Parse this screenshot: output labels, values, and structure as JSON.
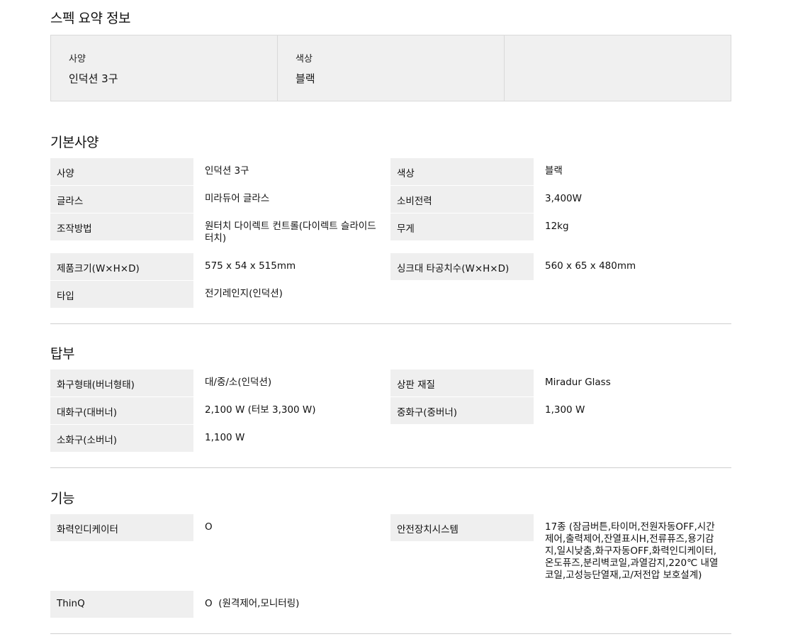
{
  "summary": {
    "title": "스펙 요약 정보",
    "items": [
      {
        "label": "사양",
        "value": "인덕션 3구"
      },
      {
        "label": "색상",
        "value": "블랙"
      },
      {
        "label": "",
        "value": ""
      }
    ]
  },
  "basic": {
    "title": "기본사양",
    "rows": [
      {
        "k1": "사양",
        "v1": "인덕션 3구",
        "k2": "색상",
        "v2": "블랙"
      },
      {
        "k1": "글라스",
        "v1": "미라듀어 글라스",
        "k2": "소비전력",
        "v2": "3,400W"
      },
      {
        "k1": "조작방법",
        "v1": "원터치 다이렉트 컨트롤(다이렉트 슬라이드 터치)",
        "k2": "무게",
        "v2": "12kg"
      },
      {
        "k1": "제품크기(W×H×D)",
        "v1": "575 x 54 x 515mm",
        "k2": "싱크대 타공치수(W×H×D)",
        "v2": "560 x 65 x 480mm"
      },
      {
        "k1": "타입",
        "v1": "전기레인지(인덕션)",
        "k2": "",
        "v2": ""
      }
    ]
  },
  "top": {
    "title": "탑부",
    "rows": [
      {
        "k1": "화구형태(버너형태)",
        "v1": "대/중/소(인덕션)",
        "k2": "상판 재질",
        "v2": "Miradur Glass"
      },
      {
        "k1": "대화구(대버너)",
        "v1": "2,100 W (터보 3,300 W)",
        "k2": "중화구(중버너)",
        "v2": "1,300 W"
      },
      {
        "k1": "소화구(소버너)",
        "v1": "1,100 W",
        "k2": "",
        "v2": ""
      }
    ]
  },
  "features": {
    "title": "기능",
    "rows": [
      {
        "k1": "화력인디케이터",
        "v1": "O",
        "k2": "안전장치시스템",
        "v2": "17종 (잠금버튼,타이머,전원자동OFF,시간제어,출력제어,잔열표시H,전류퓨즈,용기감지,일시낮춤,화구자동OFF,화력인디케이터,온도퓨즈,분리벽코일,과열감지,220℃ 내열코일,고성능단열재,고/저전압 보호설계)"
      },
      {
        "k1": "ThinQ",
        "v1": "O  (원격제어,모니터링)",
        "k2": "",
        "v2": ""
      }
    ]
  }
}
